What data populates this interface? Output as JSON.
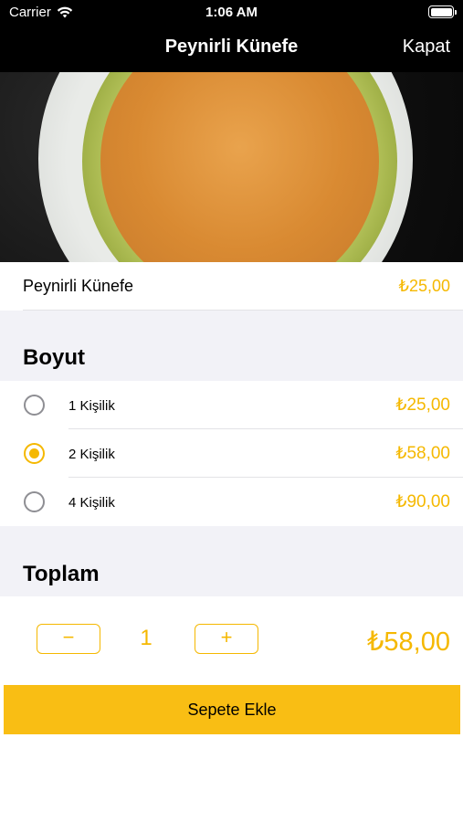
{
  "status": {
    "carrier": "Carrier",
    "time": "1:06 AM"
  },
  "nav": {
    "title": "Peynirli Künefe",
    "close_label": "Kapat"
  },
  "product": {
    "name": "Peynirli Künefe",
    "price": "₺25,00"
  },
  "size_section": {
    "title": "Boyut",
    "options": [
      {
        "label": "1 Kişilik",
        "price": "₺25,00",
        "selected": false
      },
      {
        "label": "2 Kişilik",
        "price": "₺58,00",
        "selected": true
      },
      {
        "label": "4 Kişilik",
        "price": "₺90,00",
        "selected": false
      }
    ]
  },
  "total_section": {
    "title": "Toplam",
    "minus_label": "−",
    "plus_label": "+",
    "quantity": "1",
    "total": "₺58,00"
  },
  "cart_button": {
    "label": "Sepete Ekle"
  },
  "colors": {
    "accent": "#f5b800",
    "button": "#f9be14",
    "nav_bg": "#000000",
    "group_bg": "#f2f2f7"
  }
}
